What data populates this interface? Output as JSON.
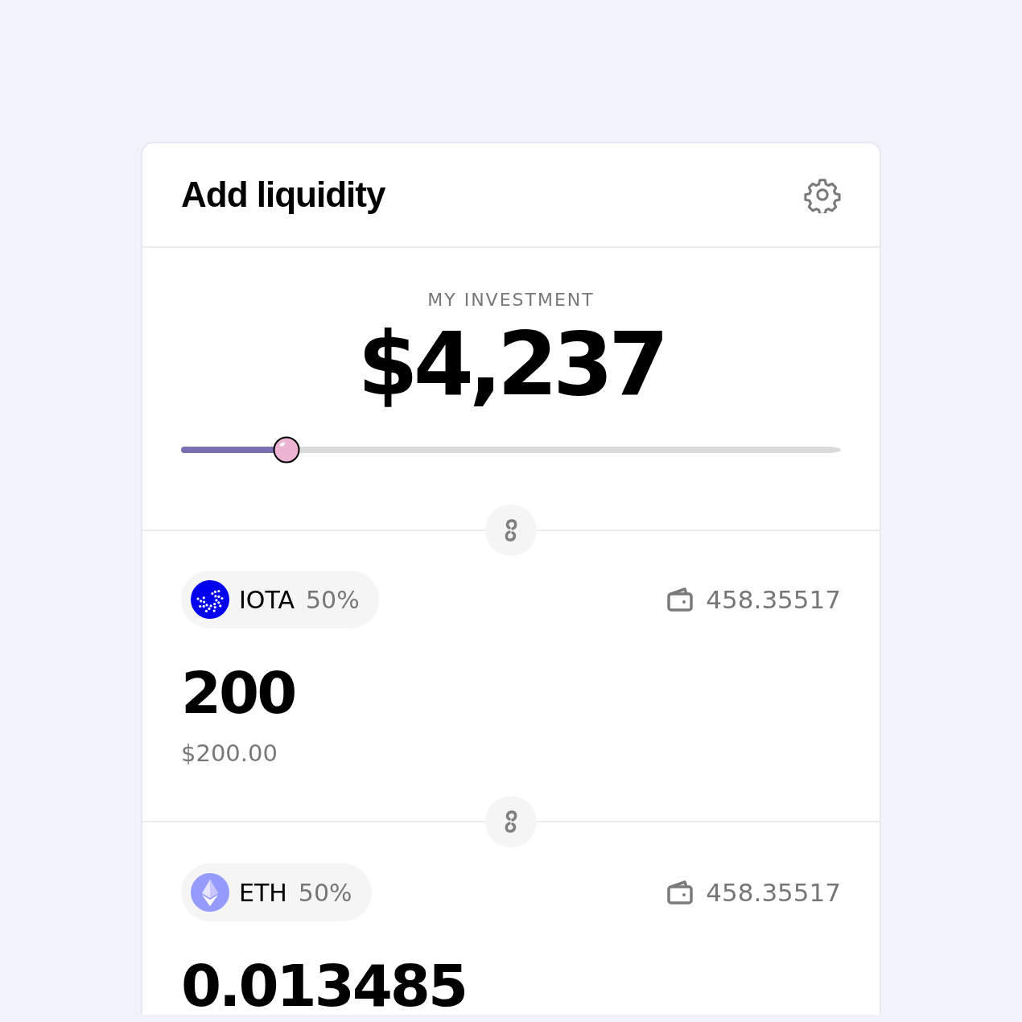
{
  "header": {
    "title": "Add liquidity"
  },
  "investment": {
    "label": "MY INVESTMENT",
    "amount": "$4,237",
    "slider": {
      "level": 0.16
    }
  },
  "tokens": [
    {
      "kind": "iota",
      "symbol": "IOTA",
      "share": "50%",
      "balance": "458.35517",
      "amount": "200",
      "usd": "$200.00"
    },
    {
      "kind": "eth",
      "symbol": "ETH",
      "share": "50%",
      "balance": "458.35517",
      "amount": "0.013485"
    }
  ]
}
